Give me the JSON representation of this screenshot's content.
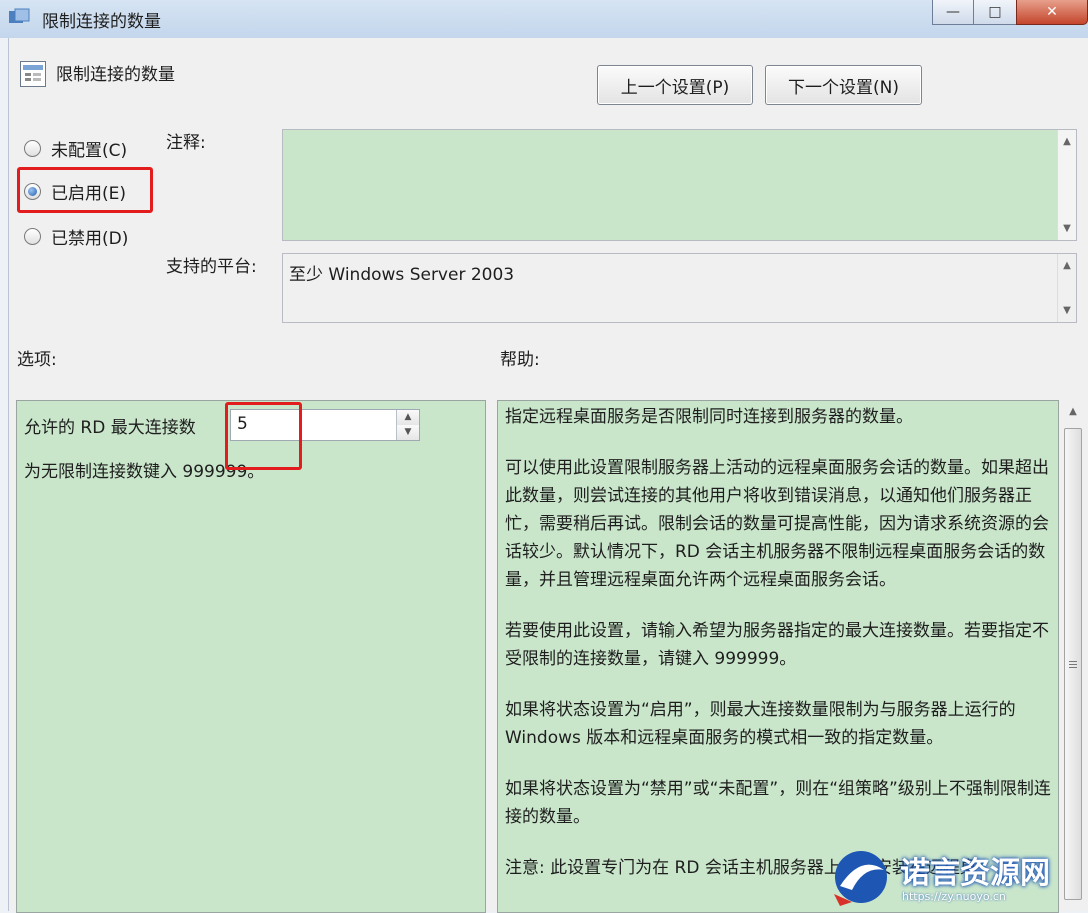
{
  "window": {
    "title": "限制连接的数量",
    "minimize": "—",
    "maximize": "□",
    "close": "✕"
  },
  "header": {
    "title": "限制连接的数量",
    "prev_button": "上一个设置(P)",
    "next_button": "下一个设置(N)"
  },
  "state": {
    "options": [
      {
        "label": "未配置(C)",
        "selected": false
      },
      {
        "label": "已启用(E)",
        "selected": true
      },
      {
        "label": "已禁用(D)",
        "selected": false
      }
    ]
  },
  "comment": {
    "label": "注释:",
    "value": ""
  },
  "platform": {
    "label": "支持的平台:",
    "value": "至少 Windows Server 2003"
  },
  "options_panel": {
    "label": "选项:",
    "field_label": "允许的 RD 最大连接数",
    "field_value": "5",
    "hint": "为无限制连接数键入 999999。"
  },
  "help_panel": {
    "label": "帮助:",
    "paragraphs": [
      "指定远程桌面服务是否限制同时连接到服务器的数量。",
      "可以使用此设置限制服务器上活动的远程桌面服务会话的数量。如果超出此数量，则尝试连接的其他用户将收到错误消息，以通知他们服务器正忙，需要稍后再试。限制会话的数量可提高性能，因为请求系统资源的会话较少。默认情况下，RD 会话主机服务器不限制远程桌面服务会话的数量，并且管理远程桌面允许两个远程桌面服务会话。",
      "若要使用此设置，请输入希望为服务器指定的最大连接数量。若要指定不受限制的连接数量，请键入 999999。",
      "如果将状态设置为“启用”，则最大连接数量限制为与服务器上运行的 Windows 版本和远程桌面服务的模式相一致的指定数量。",
      "如果将状态设置为“禁用”或“未配置”，则在“组策略”级别上不强制限制连接的数量。",
      "注意: 此设置专门为在 RD 会话主机服务器上运行安装在远程桌"
    ]
  },
  "watermark": {
    "text": "诺言资源网",
    "url": "https://zy.nuoyo.cn"
  },
  "colors": {
    "panel_green": "#c9e6cb",
    "highlight_red": "#e31d1d",
    "watermark_blue": "#1e56b4"
  }
}
